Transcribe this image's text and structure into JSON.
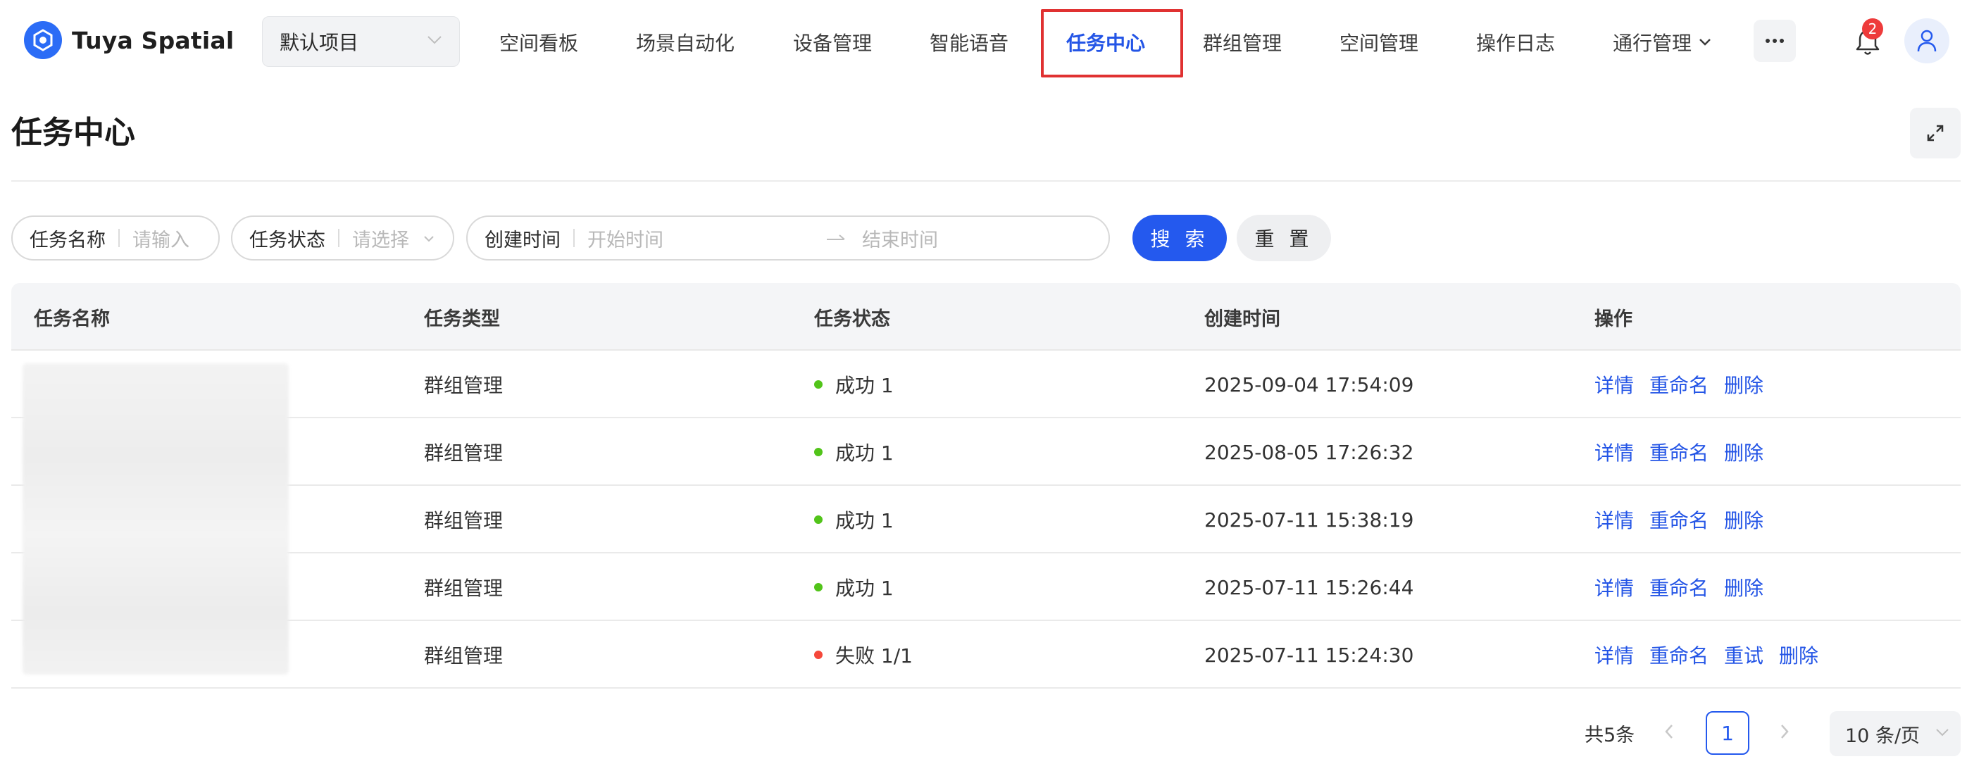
{
  "app": {
    "name": "Tuya Spatial"
  },
  "project": {
    "selected": "默认项目"
  },
  "nav": {
    "items": [
      "空间看板",
      "场景自动化",
      "设备管理",
      "智能语音",
      "任务中心",
      "群组管理",
      "空间管理",
      "操作日志",
      "通行管理"
    ],
    "active_index": 4
  },
  "notifications": {
    "count": "2"
  },
  "page": {
    "title": "任务中心"
  },
  "filters": {
    "task_name": {
      "label": "任务名称",
      "placeholder": "请输入"
    },
    "task_status": {
      "label": "任务状态",
      "placeholder": "请选择"
    },
    "created_time": {
      "label": "创建时间",
      "start_placeholder": "开始时间",
      "end_placeholder": "结束时间"
    },
    "search_label": "搜 索",
    "reset_label": "重 置"
  },
  "table": {
    "columns": [
      "任务名称",
      "任务类型",
      "任务状态",
      "创建时间",
      "操作"
    ],
    "rows": [
      {
        "type": "群组管理",
        "status": "成功 1",
        "status_color": "#52c41a",
        "created": "2025-09-04 17:54:09",
        "actions": [
          "详情",
          "重命名",
          "删除"
        ]
      },
      {
        "type": "群组管理",
        "status": "成功 1",
        "status_color": "#52c41a",
        "created": "2025-08-05 17:26:32",
        "actions": [
          "详情",
          "重命名",
          "删除"
        ]
      },
      {
        "type": "群组管理",
        "status": "成功 1",
        "status_color": "#52c41a",
        "created": "2025-07-11 15:38:19",
        "actions": [
          "详情",
          "重命名",
          "删除"
        ]
      },
      {
        "type": "群组管理",
        "status": "成功 1",
        "status_color": "#52c41a",
        "created": "2025-07-11 15:26:44",
        "actions": [
          "详情",
          "重命名",
          "删除"
        ]
      },
      {
        "type": "群组管理",
        "status": "失败 1/1",
        "status_color": "#f5483b",
        "created": "2025-07-11 15:24:30",
        "actions": [
          "详情",
          "重命名",
          "重试",
          "删除"
        ]
      }
    ]
  },
  "pagination": {
    "total": "共5条",
    "current_page": "1",
    "page_size": "10 条/页"
  },
  "colors": {
    "accent": "#2459ee",
    "highlight_box": "#e03131"
  },
  "icons": [
    "logo-icon",
    "chevron-down-icon",
    "more-icon",
    "bell-icon",
    "user-icon",
    "fullscreen-icon",
    "arrow-right-icon",
    "chevron-left-icon",
    "chevron-right-icon"
  ]
}
